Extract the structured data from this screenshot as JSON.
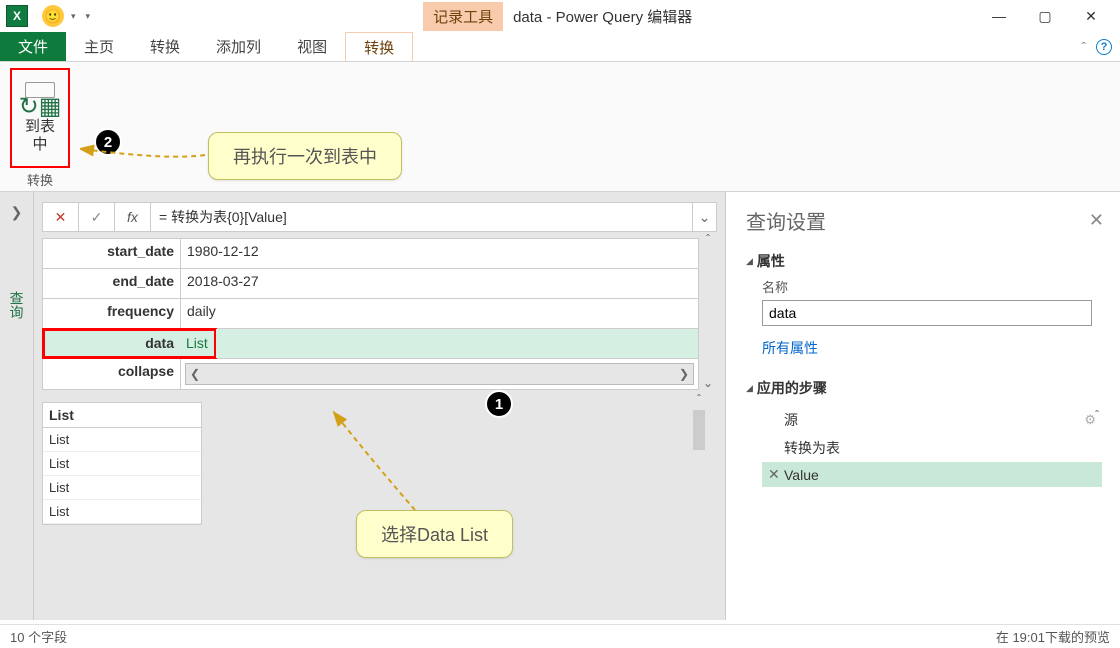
{
  "titlebar": {
    "contextual_tab": "记录工具",
    "title": "data - Power Query 编辑器"
  },
  "tabs": {
    "file": "文件",
    "home": "主页",
    "transform": "转换",
    "addcol": "添加列",
    "view": "视图",
    "ctx_transform": "转换"
  },
  "ribbon": {
    "to_table_btn": "到表\n中",
    "group_label": "转换"
  },
  "formula": {
    "fx": "fx",
    "value": "= 转换为表{0}[Value]"
  },
  "props": [
    {
      "key": "start_date",
      "val": "1980-12-12"
    },
    {
      "key": "end_date",
      "val": "2018-03-27"
    },
    {
      "key": "frequency",
      "val": "daily"
    },
    {
      "key": "data",
      "val": "List"
    },
    {
      "key": "collapse",
      "val": ""
    }
  ],
  "listbox": {
    "header": "List",
    "items": [
      "List",
      "List",
      "List",
      "List"
    ]
  },
  "rightpane": {
    "title": "查询设置",
    "sec_props": "属性",
    "lbl_name": "名称",
    "name_value": "data",
    "all_props": "所有属性",
    "sec_steps": "应用的步骤",
    "steps": [
      {
        "label": "源",
        "gear": true
      },
      {
        "label": "转换为表",
        "gear": false
      },
      {
        "label": "Value",
        "gear": false,
        "x": true,
        "sel": true
      }
    ]
  },
  "callouts": {
    "c1": "再执行一次到表中",
    "c2": "选择Data List"
  },
  "status": {
    "left": "10 个字段",
    "right": "在 19:01下载的预览"
  }
}
